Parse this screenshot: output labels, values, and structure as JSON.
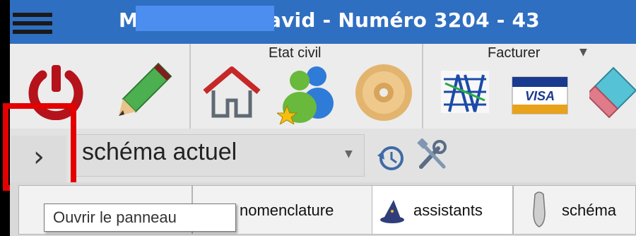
{
  "window": {
    "title": "M         R David  - Numéro 3204  -  43"
  },
  "ribbon": {
    "etat_civil_label": "Etat civil",
    "facturer_label": "Facturer"
  },
  "schema": {
    "selected": "schéma actuel"
  },
  "tabs": [
    {
      "label": "nomenclature"
    },
    {
      "label": "assistants"
    },
    {
      "label": "schéma"
    }
  ],
  "tooltip": {
    "text": "Ouvrir le panneau"
  },
  "icons": [
    "hamburger-menu-icon",
    "power-icon",
    "pencil-icon",
    "home-icon",
    "contacts-icon",
    "disc-icon",
    "sesam-vitale-icon",
    "visa-card-icon",
    "eraser-icon",
    "history-icon",
    "settings-tools-icon",
    "chevron-right-icon"
  ],
  "colors": {
    "titlebar": "#2f6fc1",
    "highlight": "#e50000"
  }
}
